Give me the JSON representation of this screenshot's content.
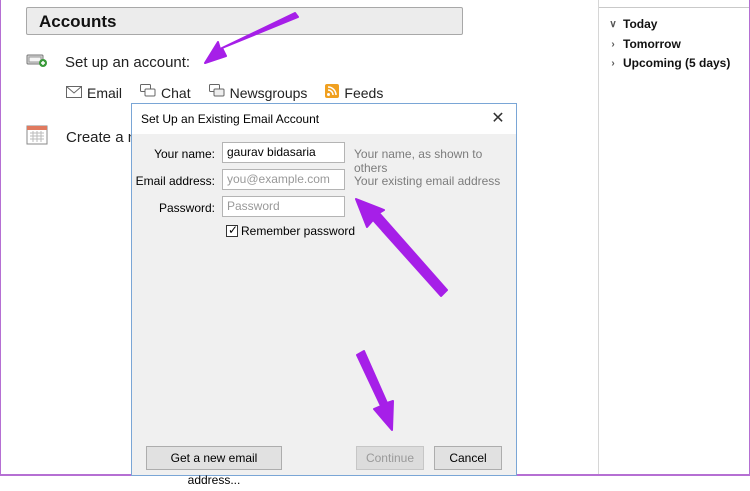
{
  "accounts": {
    "title": "Accounts",
    "setup_label": "Set up an account:",
    "options": [
      {
        "label": "Email",
        "icon": "envelope-icon"
      },
      {
        "label": "Chat",
        "icon": "chat-bubbles-icon"
      },
      {
        "label": "Newsgroups",
        "icon": "newsgroups-icon"
      },
      {
        "label": "Feeds",
        "icon": "rss-feed-icon"
      }
    ],
    "create_label": "Create a ne"
  },
  "side_pane": {
    "items": [
      {
        "label": "Today",
        "expanded": true
      },
      {
        "label": "Tomorrow",
        "expanded": false
      },
      {
        "label": "Upcoming (5 days)",
        "expanded": false
      }
    ]
  },
  "dialog": {
    "title": "Set Up an Existing Email Account",
    "name_label": "Your name:",
    "name_value": "gaurav bidasaria",
    "name_hint": "Your name, as shown to others",
    "email_label": "Email address:",
    "email_placeholder": "you@example.com",
    "email_hint": "Your existing email address",
    "password_label": "Password:",
    "password_placeholder": "Password",
    "remember_label": "Remember password",
    "remember_checked": true,
    "get_new_label": "Get a new email address...",
    "continue_label": "Continue",
    "cancel_label": "Cancel"
  },
  "colors": {
    "annotation_arrow": "#a61fe8",
    "frame": "#b56fd3"
  }
}
